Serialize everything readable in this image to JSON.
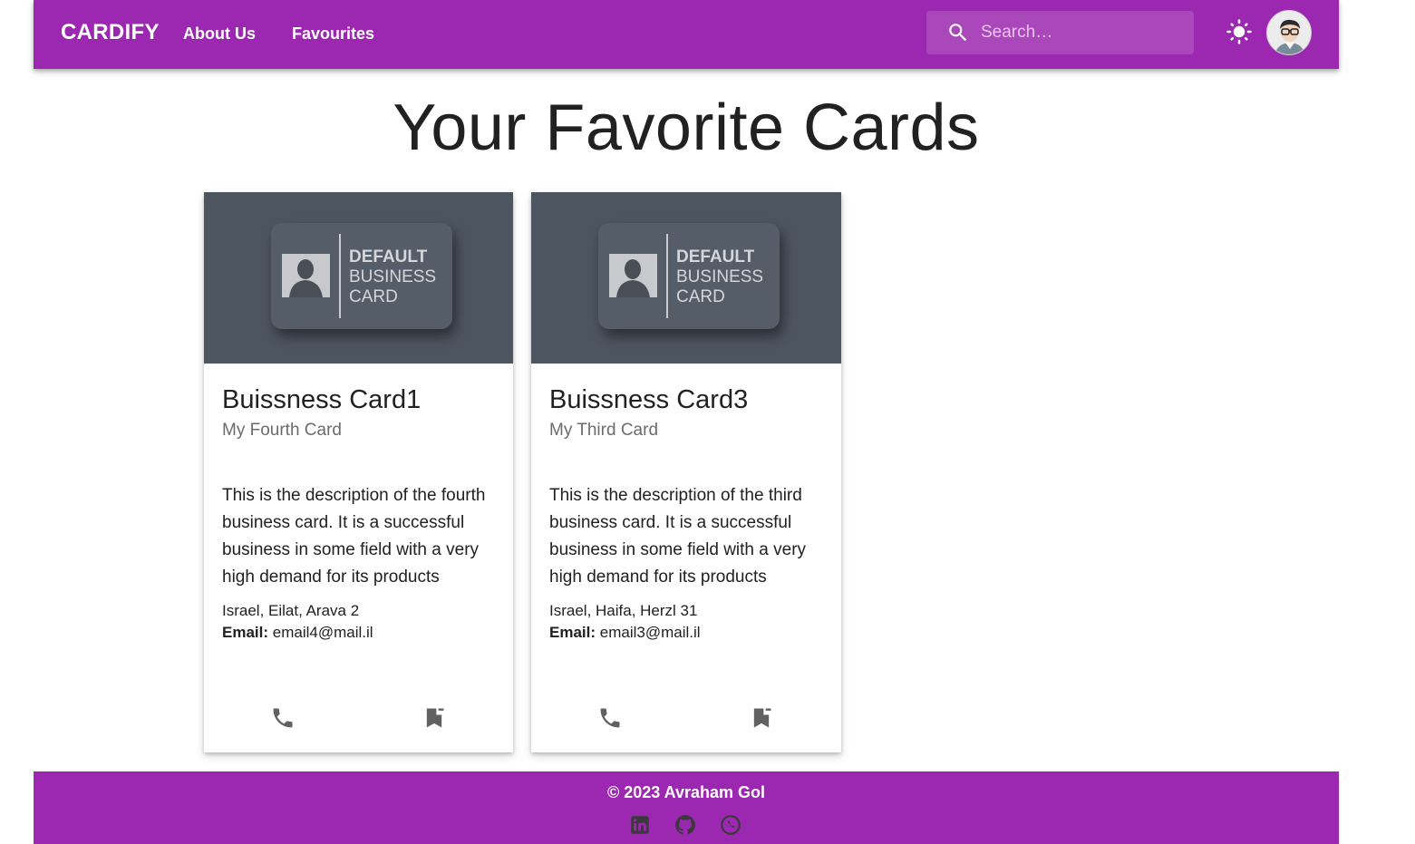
{
  "header": {
    "brand": "CARDIFY",
    "nav": [
      {
        "label": "About Us"
      },
      {
        "label": "Favourites"
      }
    ],
    "search": {
      "placeholder": "Search…",
      "value": ""
    },
    "icons": {
      "search": "search-icon",
      "theme": "sun-icon",
      "avatar": "user-avatar"
    }
  },
  "page": {
    "title": "Your Favorite Cards"
  },
  "cards": [
    {
      "image_text": [
        "DEFAULT",
        "BUSINESS",
        "CARD"
      ],
      "title": "Buissness Card1",
      "subtitle": "My Fourth Card",
      "description": "This is the description of the fourth business card. It is a successful business in some field with a very high demand for its products",
      "address": "Israel, Eilat, Arava 2",
      "email_label": "Email:",
      "email": "email4@mail.il"
    },
    {
      "image_text": [
        "DEFAULT",
        "BUSINESS",
        "CARD"
      ],
      "title": "Buissness Card3",
      "subtitle": "My Third Card",
      "description": "This is the description of the third business card. It is a successful business in some field with a very high demand for its products",
      "address": "Israel, Haifa, Herzl 31",
      "email_label": "Email:",
      "email": "email3@mail.il"
    }
  ],
  "footer": {
    "copyright": "© 2023 Avraham Gol",
    "icons": [
      "linkedin-icon",
      "github-icon",
      "whatsapp-icon"
    ]
  },
  "colors": {
    "primary": "#9c27b0",
    "card_media": "#4d5560",
    "text": "#212121",
    "subtitle": "#6b6b6b",
    "icon": "#616161"
  }
}
